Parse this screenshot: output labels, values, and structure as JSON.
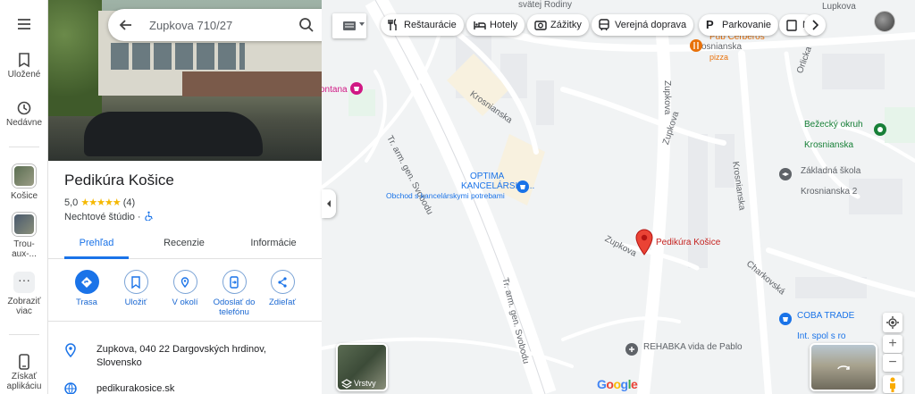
{
  "rail": {
    "saved_label": "Uložené",
    "recent_label": "Nedávne",
    "recent1_label": "Košice",
    "recent2_label": "Trou-aux-...",
    "more_label": "Zobraziť viac",
    "get_app_label": "Získať aplikáciu"
  },
  "search": {
    "value": "Zupkova 710/27"
  },
  "place": {
    "name": "Pedikúra Košice",
    "rating": "5,0",
    "stars": "★★★★★",
    "reviews": "(4)",
    "category": "Nechtové štúdio ·"
  },
  "tabs": [
    "Prehľad",
    "Recenzie",
    "Informácie"
  ],
  "actions": [
    "Trasa",
    "Uložiť",
    "V okolí",
    "Odoslať do telefónu",
    "Zdieľať"
  ],
  "info": {
    "address": "Zupkova, 040 22 Dargovských hrdinov, Slovensko",
    "website": "pedikurakosice.sk"
  },
  "chips": [
    "Reštaurácie",
    "Hotely",
    "Zážitky",
    "Verejná doprava",
    "Parkovanie",
    "N"
  ],
  "map": {
    "streets": {
      "svoboda1": "Tr. arm. gen. Svobodu",
      "svoboda2": "Tr. arm. gen. Svobodu",
      "krosnianska1": "Krosnianska",
      "krosnianska2": "Krosnianska",
      "krosnianska3": "Krosnianska",
      "zupkova1": "Zupkova",
      "zupkova2": "Zupkova",
      "zupkova3": "Zupkova",
      "lupkova": "Lupkova",
      "orlicka": "Orlicka",
      "charkovska": "Charkovská",
      "rodiny": "svätej Rodiny"
    },
    "pois": {
      "fontana": "ontana",
      "optima1": "OPTIMA",
      "optima2": "KANCELÁRSKA...",
      "optima_sub": "Obchod s kancelárskymi potrebami",
      "bezecky1": "Bežecký okruh",
      "bezecky2": "Krosnianska",
      "skola1": "Základná škola",
      "skola2": "Krosnianska 2",
      "cerberos1": "Pub Cerberos",
      "cerberos2": "pizza",
      "coba1": "COBA TRADE",
      "coba2": "Int. spol s ro",
      "rehabka": "REHABKA vida de Pablo",
      "pin_label": "Pedikúra Košice"
    },
    "layers_label": "Vrstvy",
    "zoom_in": "+",
    "zoom_out": "−"
  },
  "colors": {
    "accent": "#1a73e8",
    "pin": "#ea4335",
    "poi_blue": "#1a73e8",
    "poi_green": "#188038",
    "poi_orange": "#e8710a",
    "poi_pink": "#d01884",
    "poi_gray": "#5f6368",
    "star": "#f5b800"
  }
}
